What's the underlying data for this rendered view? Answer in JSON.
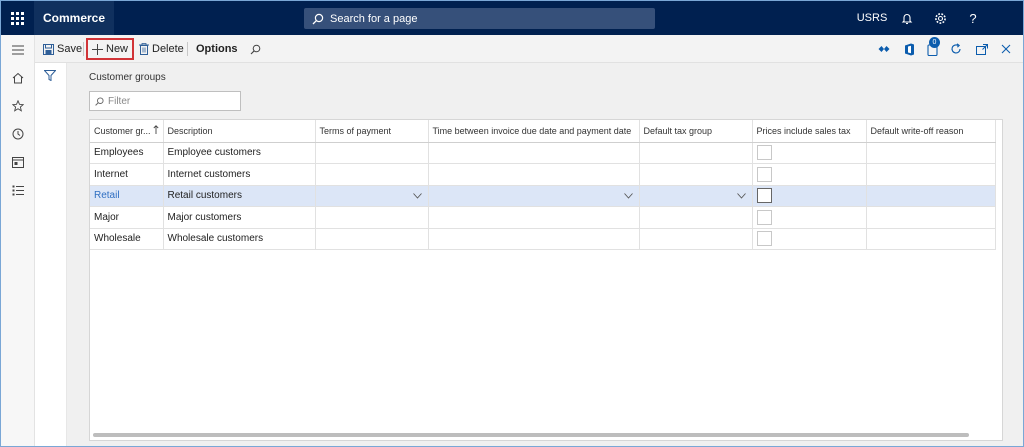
{
  "app": {
    "title": "Commerce",
    "search_placeholder": "Search for a page",
    "company": "USRS",
    "help_label": "?"
  },
  "icons": {
    "waffle": "waffle-icon",
    "search": "search-icon",
    "bell": "bell-icon",
    "gear": "gear-icon",
    "hamburger": "hamburger-icon",
    "home": "home-icon",
    "star": "star-icon",
    "clock": "clock-icon",
    "workspace": "workspace-icon",
    "modules": "modules-icon",
    "filter": "filter-icon"
  },
  "toolbar": {
    "save_label": "Save",
    "new_label": "New",
    "delete_label": "Delete",
    "options_label": "Options",
    "attachments_count": "0"
  },
  "page": {
    "title": "Customer groups",
    "filter_placeholder": "Filter"
  },
  "grid": {
    "columns": [
      "Customer gr...",
      "Description",
      "Terms of payment",
      "Time between invoice due date and payment date",
      "Default tax group",
      "Prices include sales tax",
      "Default write-off reason"
    ],
    "rows": [
      {
        "group": "Employees",
        "description": "Employee customers",
        "selected": false
      },
      {
        "group": "Internet",
        "description": "Internet customers",
        "selected": false
      },
      {
        "group": "Retail",
        "description": "Retail customers",
        "selected": true
      },
      {
        "group": "Major",
        "description": "Major customers",
        "selected": false
      },
      {
        "group": "Wholesale",
        "description": "Wholesale customers",
        "selected": false
      }
    ]
  },
  "colors": {
    "nav_bg": "#002050",
    "brand_bg": "#10305e",
    "selected_row": "#dce6f7",
    "highlight_border": "#d13438",
    "link_blue": "#2f6fc2"
  }
}
